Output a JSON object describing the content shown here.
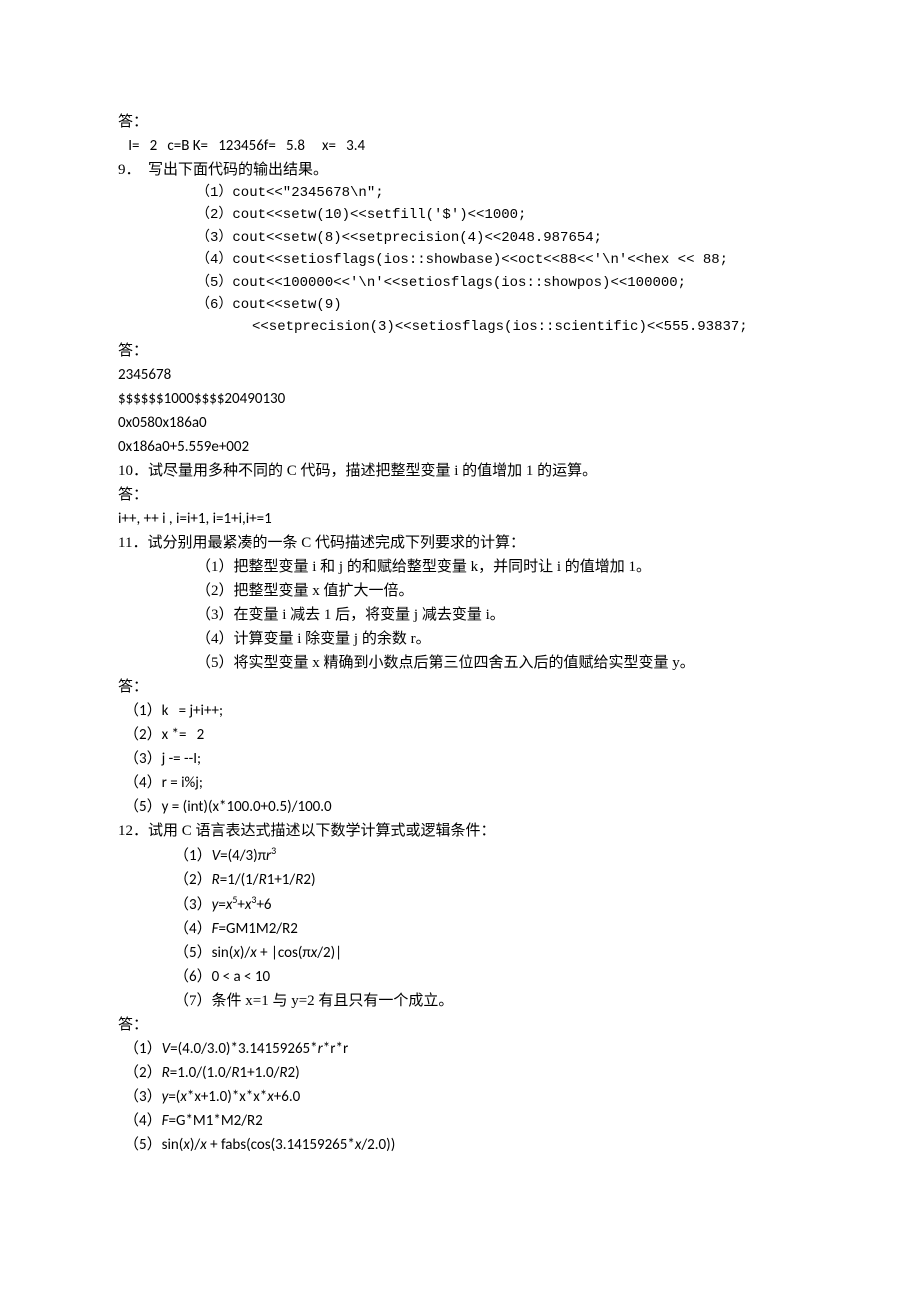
{
  "p1": "答：",
  "p2": "   I=   2   c=B K=   123456f=   5.8     x=   3.4",
  "q9": {
    "title": "9．  写出下面代码的输出结果。",
    "c1": "（1）cout<<\"2345678\\n\";",
    "c2": "（2）cout<<setw(10)<<setfill('$')<<1000;",
    "c3": "（3）cout<<setw(8)<<setprecision(4)<<2048.987654;",
    "c4": "（4）cout<<setiosflags(ios::showbase)<<oct<<88<<'\\n'<<hex << 88;",
    "c5": "（5）cout<<100000<<'\\n'<<setiosflags(ios::showpos)<<100000;",
    "c6": "（6）cout<<setw(9)",
    "c6b": "<<setprecision(3)<<setiosflags(ios::scientific)<<555.93837;",
    "ans_label": "答：",
    "a1": "2345678",
    "a2": "$$$$$$1000$$$$20490130",
    "a3": "0x0580x186a0",
    "a4": "0x186a0+5.559e+002"
  },
  "q10": {
    "title": "10．试尽量用多种不同的 C 代码，描述把整型变量 i 的值增加 1 的运算。",
    "ans_label": "答：",
    "a": "i++, ++ i , i=i+1, i=1+i,i+=1"
  },
  "q11": {
    "title": "11．试分别用最紧凑的一条 C 代码描述完成下列要求的计算：",
    "s1": "（1）把整型变量 i 和 j 的和赋给整型变量 k，并同时让 i 的值增加 1。",
    "s2": "（2）把整型变量 x 值扩大一倍。",
    "s3": "（3）在变量 i 减去 1 后，将变量 j 减去变量 i。",
    "s4": "（4）计算变量 i 除变量 j 的余数 r。",
    "s5": "（5）将实型变量 x 精确到小数点后第三位四舍五入后的值赋给实型变量 y。",
    "ans_label": "答：",
    "a1": "（1）k   = j+i++;",
    "a2": "（2）x *=   2",
    "a3": "（3）j -= --I;",
    "a4": "（4）r = i%j;",
    "a5": "（5）y = (int)(x*100.0+0.5)/100.0"
  },
  "q12": {
    "title": "12．试用 C 语言表达式描述以下数学计算式或逻辑条件：",
    "s1_pre": "（1）",
    "s1_v": "V",
    "s1_eq": "=(4/3)π",
    "s1_r": "r",
    "s1_exp": "3",
    "s2_pre": "（2）",
    "s2_R": "R",
    "s2_mid": "=1/(1/",
    "s2_R2": "R",
    "s2_mid2": "1+1/",
    "s2_R3": "R",
    "s2_end": "2)",
    "s3_pre": "（3）",
    "s3_y": "y",
    "s3_eq": "=",
    "s3_x1": "x",
    "s3_e1": "5",
    "s3_plus": "+",
    "s3_x2": "x",
    "s3_e2": "3",
    "s3_end": "+6",
    "s4_pre": "（4）",
    "s4_F": "F",
    "s4_rest": "=GM1M2/R2",
    "s5_pre": "（5）sin(",
    "s5_x1": "x",
    "s5_mid": ")/",
    "s5_x2": "x",
    "s5_mid2": " + |cos(π",
    "s5_x3": "x",
    "s5_end": "/2)|",
    "s6": "（6）0 < a < 10",
    "s7": "（7）条件 x=1 与 y=2 有且只有一个成立。",
    "ans_label": "答：",
    "a1_pre": "（1）",
    "a1_V": "V",
    "a1_mid": "=(4.0/3.0)*3.14159265*",
    "a1_r": "r",
    "a1_end": "*r*r",
    "a2_pre": "（2）",
    "a2_R": "R",
    "a2_mid": "=1.0/(1.0/",
    "a2_R2": "R",
    "a2_mid2": "1+1.0/",
    "a2_R3": "R",
    "a2_end": "2)",
    "a3_pre": "（3）",
    "a3_y": "y",
    "a3_mid": "=(",
    "a3_x1": "x",
    "a3_mid2": "*x+1.0)*x*x*",
    "a3_x2": "x",
    "a3_end": "+6.0",
    "a4_pre": "（4）",
    "a4_F": "F",
    "a4_rest": "=G*M1*M2/R2",
    "a5_pre": "（5）sin(",
    "a5_x1": "x",
    "a5_mid": ")/",
    "a5_x2": "x",
    "a5_mid2": " + fabs(cos(3.14159265*",
    "a5_x3": "x",
    "a5_end": "/2.0))"
  }
}
